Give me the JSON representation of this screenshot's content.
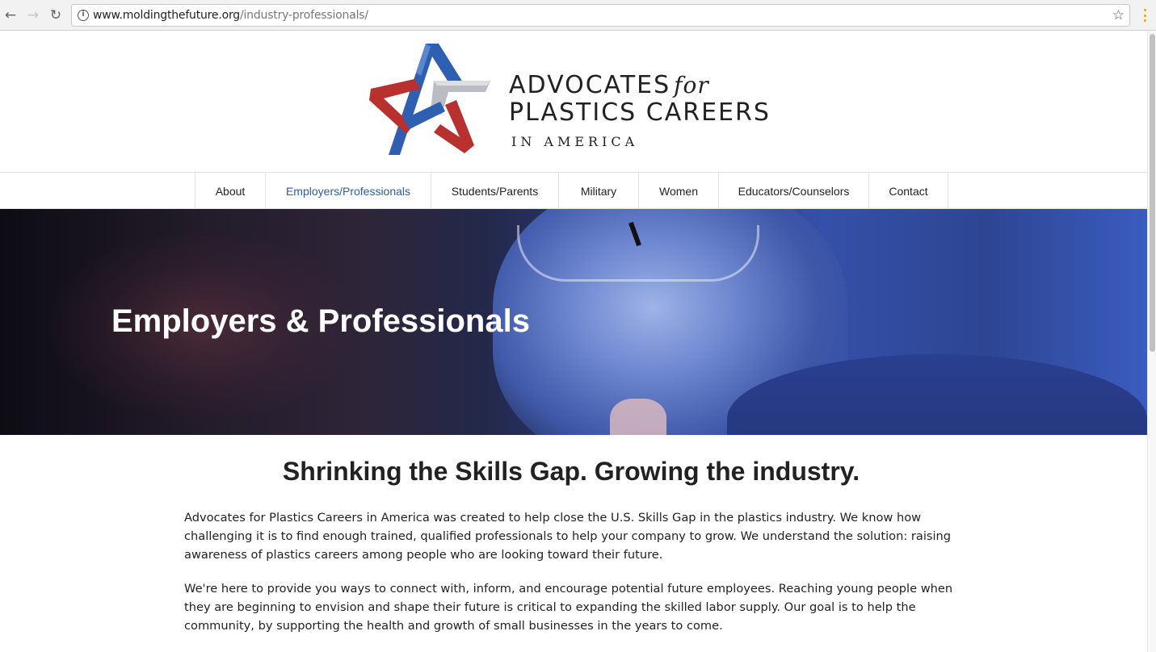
{
  "browser": {
    "url_host": "www.moldingthefuture.org",
    "url_path": "/industry-professionals/",
    "back_icon": "←",
    "forward_icon": "→",
    "reload_icon": "↻",
    "info_icon": "i",
    "star_icon": "☆"
  },
  "logo": {
    "line1": "ADVOCATES",
    "for": "for",
    "line2": "PLASTICS CAREERS",
    "line3": "IN AMERICA",
    "colors": {
      "blue": "#2f5fb0",
      "red": "#b8312f",
      "gray": "#b9bcc2"
    }
  },
  "nav": {
    "items": [
      {
        "label": "About"
      },
      {
        "label": "Employers/Professionals",
        "active": true
      },
      {
        "label": "Students/Parents"
      },
      {
        "label": "Military"
      },
      {
        "label": "Women"
      },
      {
        "label": "Educators/Counselors"
      },
      {
        "label": "Contact"
      }
    ],
    "active_color": "#2f5d9e"
  },
  "hero": {
    "title": "Employers & Professionals"
  },
  "content": {
    "heading": "Shrinking the Skills Gap. Growing the industry.",
    "paragraph1": "Advocates for Plastics Careers in America was created to help close the U.S. Skills Gap in the plastics industry. We know how challenging it is to find enough trained, qualified professionals to help your company to grow. We understand the solution: raising awareness of plastics careers among people who are looking toward their future.",
    "paragraph2": "We're here to provide you ways to connect with, inform, and encourage potential future employees. Reaching young people when they are beginning to envision and shape their future is critical to expanding the skilled labor supply. Our goal is to help the community, by supporting the health and growth of small businesses in the years to come."
  }
}
